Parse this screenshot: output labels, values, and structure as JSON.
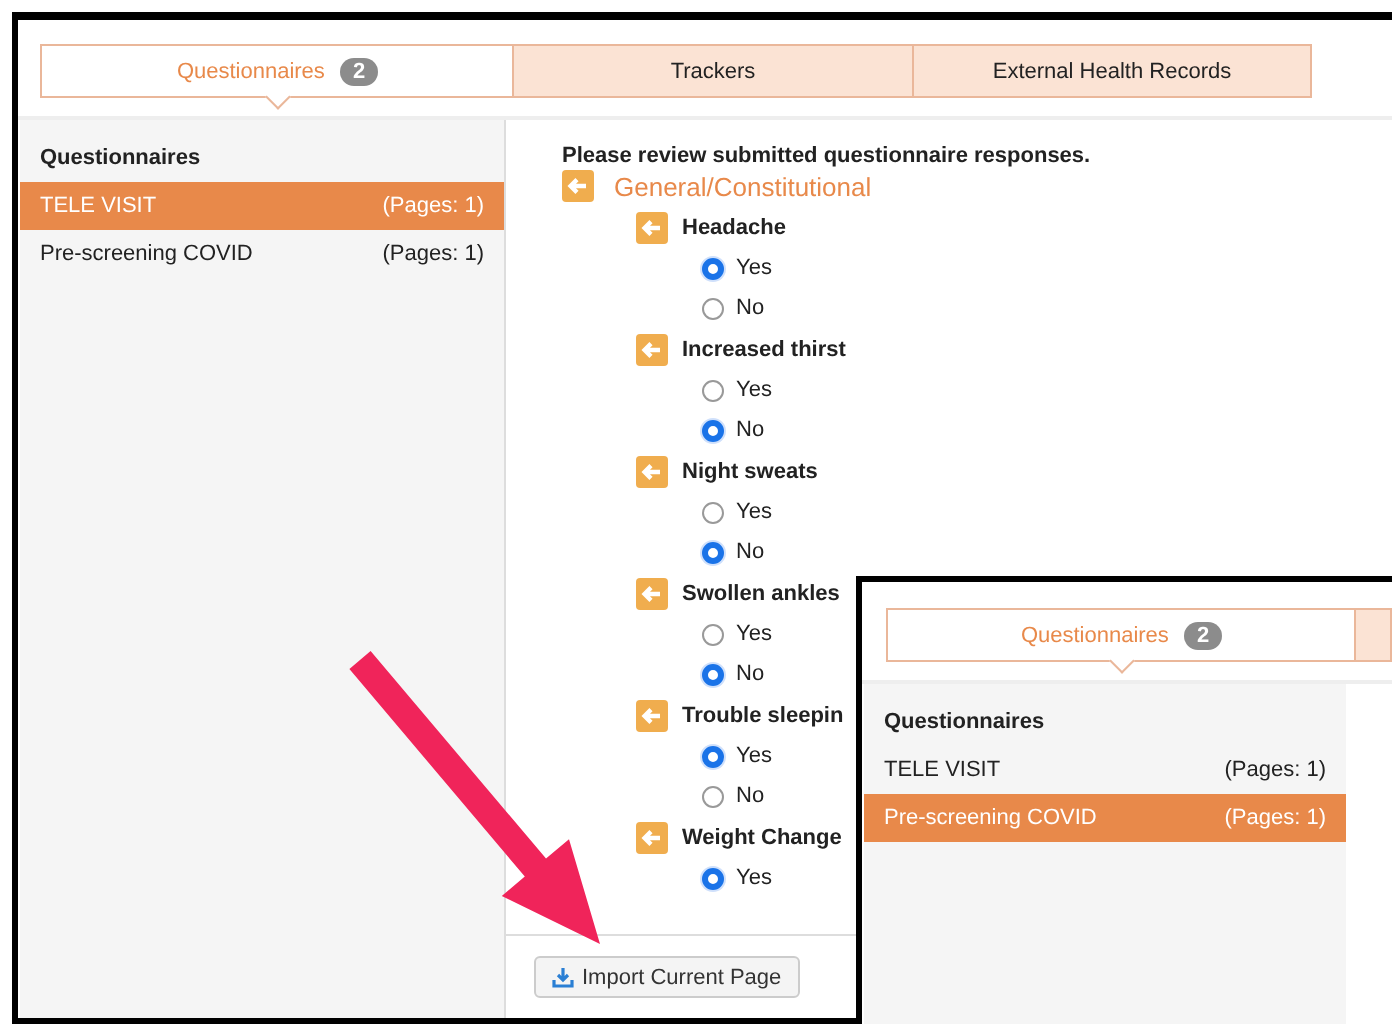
{
  "main_window": {
    "tabs": [
      {
        "label": "Questionnaires",
        "badge": "2",
        "selected": true
      },
      {
        "label": "Trackers",
        "selected": false
      },
      {
        "label": "External Health Records",
        "selected": false
      }
    ],
    "sidebar": {
      "title": "Questionnaires",
      "items": [
        {
          "name": "TELE VISIT",
          "pages": "(Pages: 1)",
          "selected": true
        },
        {
          "name": "Pre-screening COVID",
          "pages": "(Pages: 1)",
          "selected": false
        }
      ]
    },
    "content": {
      "instruction": "Please review submitted questionnaire responses.",
      "section": "General/Constitutional",
      "questions": [
        {
          "label": "Headache",
          "options": [
            {
              "label": "Yes",
              "selected": true
            },
            {
              "label": "No",
              "selected": false
            }
          ]
        },
        {
          "label": "Increased thirst",
          "options": [
            {
              "label": "Yes",
              "selected": false
            },
            {
              "label": "No",
              "selected": true
            }
          ]
        },
        {
          "label": "Night sweats",
          "options": [
            {
              "label": "Yes",
              "selected": false
            },
            {
              "label": "No",
              "selected": true
            }
          ]
        },
        {
          "label": "Swollen ankles",
          "options": [
            {
              "label": "Yes",
              "selected": false
            },
            {
              "label": "No",
              "selected": true
            }
          ]
        },
        {
          "label": "Trouble sleepin",
          "options": [
            {
              "label": "Yes",
              "selected": true
            },
            {
              "label": "No",
              "selected": false
            }
          ]
        },
        {
          "label": "Weight Change",
          "options": [
            {
              "label": "Yes",
              "selected": true
            }
          ]
        }
      ]
    },
    "toolbar": {
      "buttons": [
        {
          "label": "Import Current Page"
        }
      ]
    }
  },
  "overlay_window": {
    "tabs": [
      {
        "label": "Questionnaires",
        "badge": "2",
        "selected": true
      }
    ],
    "sidebar": {
      "title": "Questionnaires",
      "items": [
        {
          "name": "TELE VISIT",
          "pages": "(Pages: 1)",
          "selected": false
        },
        {
          "name": "Pre-screening COVID",
          "pages": "(Pages: 1)",
          "selected": true
        }
      ]
    }
  }
}
